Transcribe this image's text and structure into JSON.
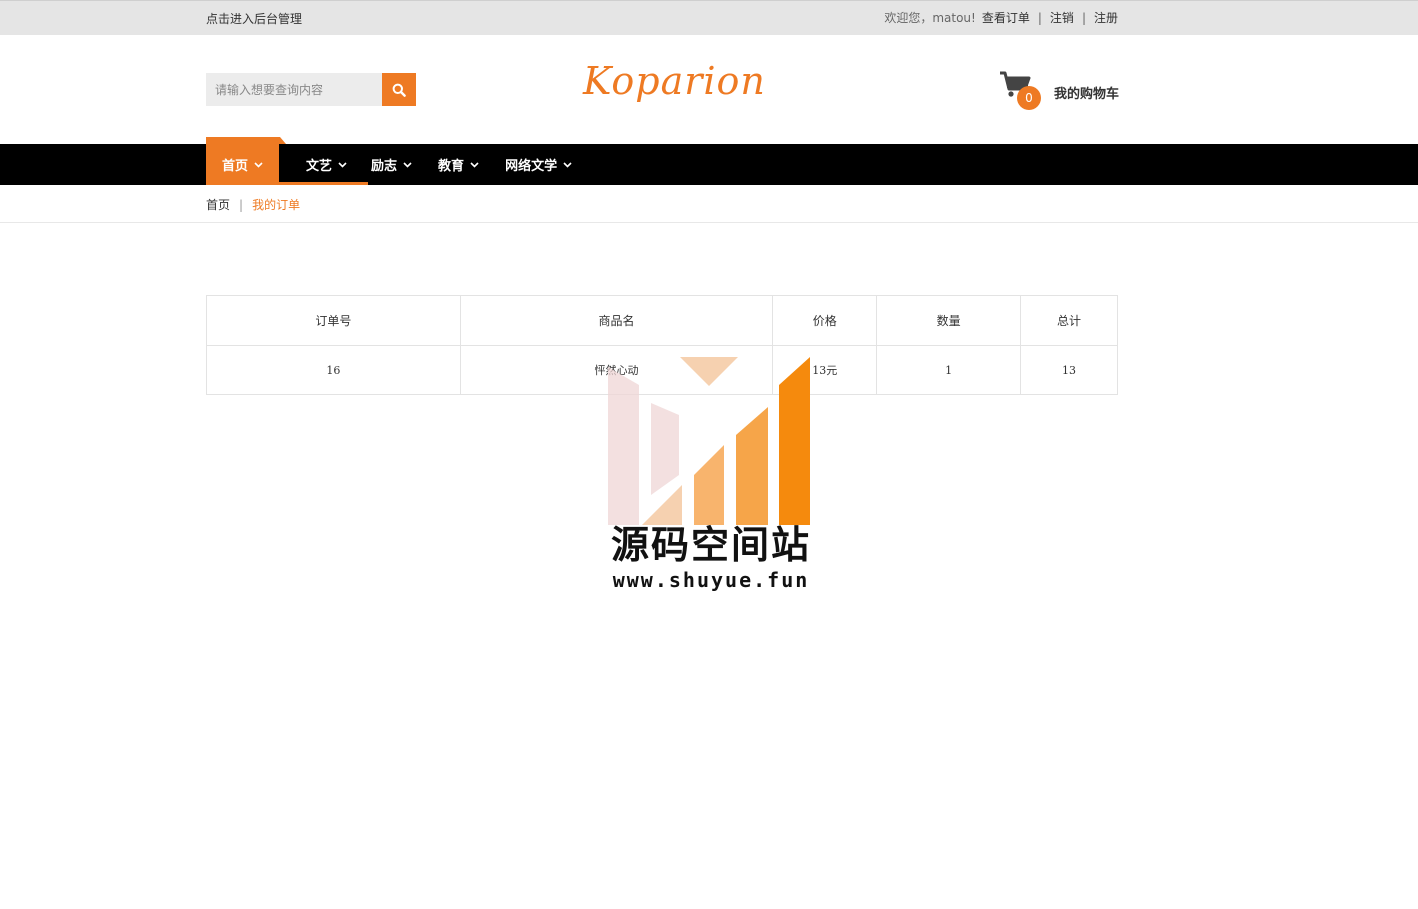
{
  "topbar": {
    "admin_link": "点击进入后台管理",
    "welcome": "欢迎您，matou!",
    "view_orders": "查看订单",
    "logout": "注销",
    "register": "注册",
    "separator": "|"
  },
  "header": {
    "search_placeholder": "请输入想要查询内容",
    "search_icon": "search-icon",
    "logo_text": "Koparion",
    "cart_count": "0",
    "cart_label": "我的购物车",
    "cart_icon": "shopping-cart-icon"
  },
  "nav": {
    "items": [
      {
        "label": "首页"
      },
      {
        "label": "文艺"
      },
      {
        "label": "励志"
      },
      {
        "label": "教育"
      },
      {
        "label": "网络文学"
      }
    ]
  },
  "breadcrumb": {
    "home": "首页",
    "separator": "|",
    "current": "我的订单"
  },
  "orders": {
    "headers": [
      "订单号",
      "商品名",
      "价格",
      "数量",
      "总计"
    ],
    "rows": [
      {
        "order_no": "16",
        "product": "怦然心动",
        "price": "13元",
        "quantity": "1",
        "total": "13"
      }
    ]
  },
  "watermark": {
    "title": "源码空间站",
    "url": "www.shuyue.fun"
  },
  "colors": {
    "accent": "#ee7a23",
    "navbar": "#000000",
    "topbar": "#e5e5e5"
  }
}
